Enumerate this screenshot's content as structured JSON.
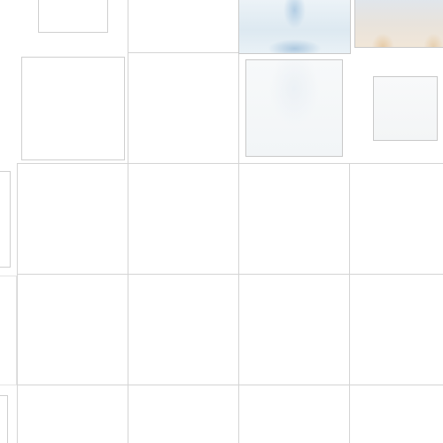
{
  "view": {
    "type": "image-thumbnail-grid",
    "background_color": "#ffffff",
    "gridline_color": "#d4d4d4"
  },
  "thumbnails": [
    {
      "name": "thumb-r0-c0",
      "image": "blank"
    },
    {
      "name": "thumb-r0-c2",
      "image": "fountain-photo"
    },
    {
      "name": "thumb-r0-c3",
      "image": "building-photo"
    },
    {
      "name": "thumb-r1-c0",
      "image": "blank"
    },
    {
      "name": "thumb-r1-c2",
      "image": "misty-fountain-photo"
    },
    {
      "name": "thumb-r1-c3",
      "image": "pale-photo"
    },
    {
      "name": "thumb-left-edge-1",
      "image": "blank"
    },
    {
      "name": "thumb-left-edge-2",
      "image": "blank"
    }
  ]
}
